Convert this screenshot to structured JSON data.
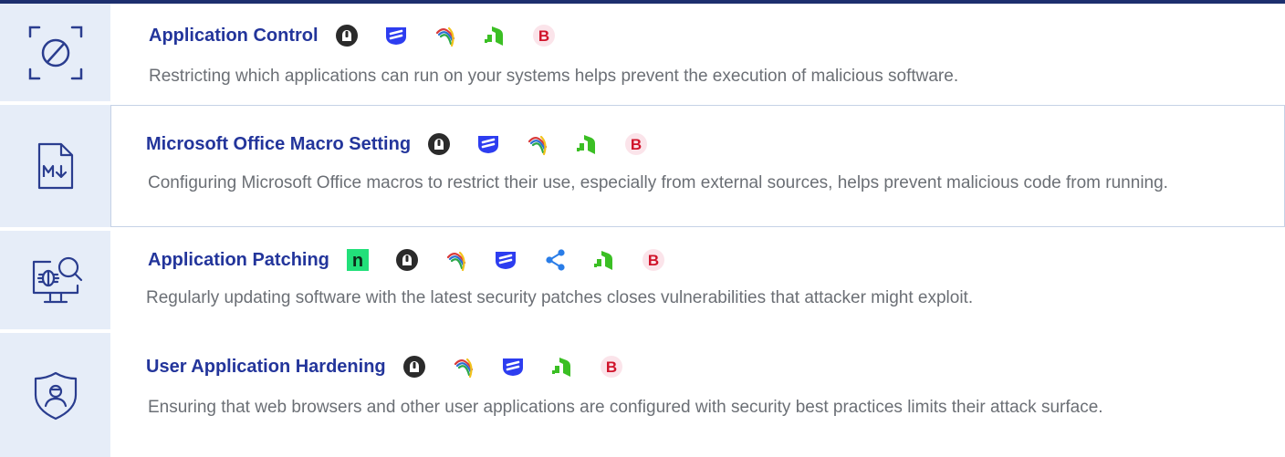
{
  "controls": [
    {
      "title": "Application Control",
      "icon": "blocked-circle-icon",
      "vendors": [
        "lock-shield-logo",
        "blue-stripes-logo",
        "rainbow-arc-logo",
        "green-steps-logo",
        "red-b-logo"
      ],
      "description": "Restricting which applications can run on your systems helps prevent the execution of malicious software."
    },
    {
      "title": "Microsoft Office Macro Setting",
      "icon": "markdown-file-icon",
      "vendors": [
        "lock-shield-logo",
        "blue-stripes-logo",
        "rainbow-arc-logo",
        "green-steps-logo",
        "red-b-logo"
      ],
      "description": "Configuring Microsoft Office macros to restrict their use, especially from external sources, helps prevent malicious code from running."
    },
    {
      "title": "Application Patching",
      "icon": "bug-monitor-search-icon",
      "vendors": [
        "n-square-logo",
        "lock-shield-logo",
        "rainbow-arc-logo",
        "blue-stripes-logo",
        "share-nodes-logo",
        "green-steps-logo",
        "red-b-logo"
      ],
      "description": "Regularly updating software with the latest security patches closes vulnerabilities that attacker might exploit."
    },
    {
      "title": "User Application Hardening",
      "icon": "user-shield-icon",
      "vendors": [
        "lock-shield-logo",
        "rainbow-arc-logo",
        "blue-stripes-logo",
        "green-steps-logo",
        "red-b-logo"
      ],
      "description": "Ensuring that web browsers and other user applications are configured with security best practices limits their attack surface."
    }
  ],
  "badges": {
    "n_letter": "n",
    "b_letter": "B"
  },
  "colors": {
    "title": "#23359b",
    "description": "#6b6f75",
    "icon_panel": "#e6edf8",
    "border": "#c5d2e6",
    "top_bar": "#1d2f6e"
  }
}
